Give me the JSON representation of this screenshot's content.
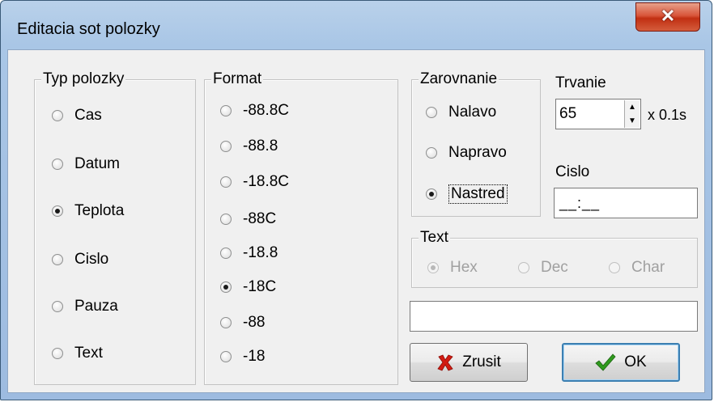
{
  "window": {
    "title": "Editacia sot polozky",
    "close_icon": "close-icon"
  },
  "typ_polozky": {
    "legend": "Typ polozky",
    "options": [
      "Cas",
      "Datum",
      "Teplota",
      "Cislo",
      "Pauza",
      "Text"
    ],
    "selected": "Teplota"
  },
  "format": {
    "legend": "Format",
    "options": [
      "-88.8C",
      "-88.8",
      "-18.8C",
      "-88C",
      "-18.8",
      "-18C",
      "-88",
      "-18"
    ],
    "selected": "-18C"
  },
  "zarovnanie": {
    "legend": "Zarovnanie",
    "options": [
      "Nalavo",
      "Napravo",
      "Nastred"
    ],
    "selected": "Nastred"
  },
  "trvanie": {
    "label": "Trvanie",
    "value": "65",
    "unit": "x 0.1s"
  },
  "cislo": {
    "label": "Cislo",
    "value": "__:__"
  },
  "text_group": {
    "legend": "Text",
    "options": [
      "Hex",
      "Dec",
      "Char"
    ],
    "selected": "Hex",
    "enabled": false
  },
  "text_input": {
    "value": ""
  },
  "buttons": {
    "cancel_label": "Zrusit",
    "cancel_icon": "red-x-icon",
    "ok_label": "OK",
    "ok_icon": "green-checkmark-icon"
  }
}
